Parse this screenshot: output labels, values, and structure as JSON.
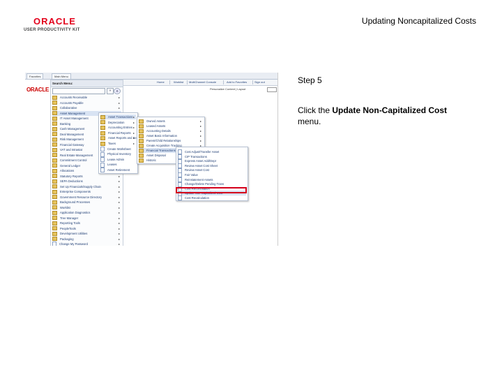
{
  "header": {
    "logo_brand": "ORACLE",
    "logo_sub": "USER PRODUCTIVITY KIT",
    "title": "Updating Noncapitalized Costs"
  },
  "step": {
    "label": "Step 5",
    "instruction_prefix": "Click the ",
    "instruction_bold": "Update Non-Capitalized Cost",
    "instruction_suffix": " menu."
  },
  "screenshot": {
    "tabs": [
      "Favorites",
      "Main Menu"
    ],
    "nav_links": [
      "Home",
      "Worklist",
      "MultiChannel Console",
      "Add to Favorites",
      "Sign out"
    ],
    "oracle_mark": "ORACLE",
    "personalize": "Personalize Content | Layout",
    "panel_title": "Search Menu:",
    "search_go": "»",
    "search_adv": "⚙",
    "main_menu": [
      "Accounts Receivable",
      "Accounts Payable",
      "Collaborative",
      "Asset Management",
      "IT Asset Management",
      "Banking",
      "Cash Management",
      "Deal Management",
      "Risk Management",
      "Financial Gateway",
      "VAT and Intrastat",
      "Real Estate Management",
      "Commitment Control",
      "General Ledger",
      "Allocations",
      "Statutory Reports",
      "SEPA Deductions",
      "Set Up Financials/Supply Chain",
      "Enterprise Components",
      "Government Resource Directory",
      "Background Processes",
      "Worklist",
      "Application Diagnostics",
      "Tree Manager",
      "Reporting Tools",
      "PeopleTools",
      "Development Utilities",
      "Packaging",
      "Change My Password"
    ],
    "asset_menu": [
      "Asset Transactions",
      "Depreciation",
      "Accounting Entries",
      "Financial Reports",
      "Asset Reports and Search",
      "Taxes",
      "Create Worksheet",
      "Physical Inventory",
      "Lease Admin",
      "Leases",
      "Asset Retirement"
    ],
    "transactions_menu": [
      "Owned Assets",
      "Leased Assets",
      "Accounting Details",
      "Asset Basic Information",
      "Parent/Child Relationships",
      "Create Acquisition Tracking",
      "Financial Transactions",
      "Asset Disposal",
      "Historic"
    ],
    "financial_menu": [
      "Cost Adjust/Transfer Asset",
      "CIP Transactions",
      "Express Asset Add/Depr",
      "Review Asset Cost Sheet",
      "Review Asset Cost",
      "Fair Value",
      "Reinstatement Assets",
      "Change/Delete Pending Trans",
      "Cost Reconciliation",
      "Update Non-Capitalized Cost",
      "Cost Recalculation"
    ]
  },
  "colors": {
    "oracle_red": "#e3001b",
    "menu_link": "#1c3b72",
    "highlight_border": "#d4001a",
    "folder_icon": "#e6c35c"
  }
}
